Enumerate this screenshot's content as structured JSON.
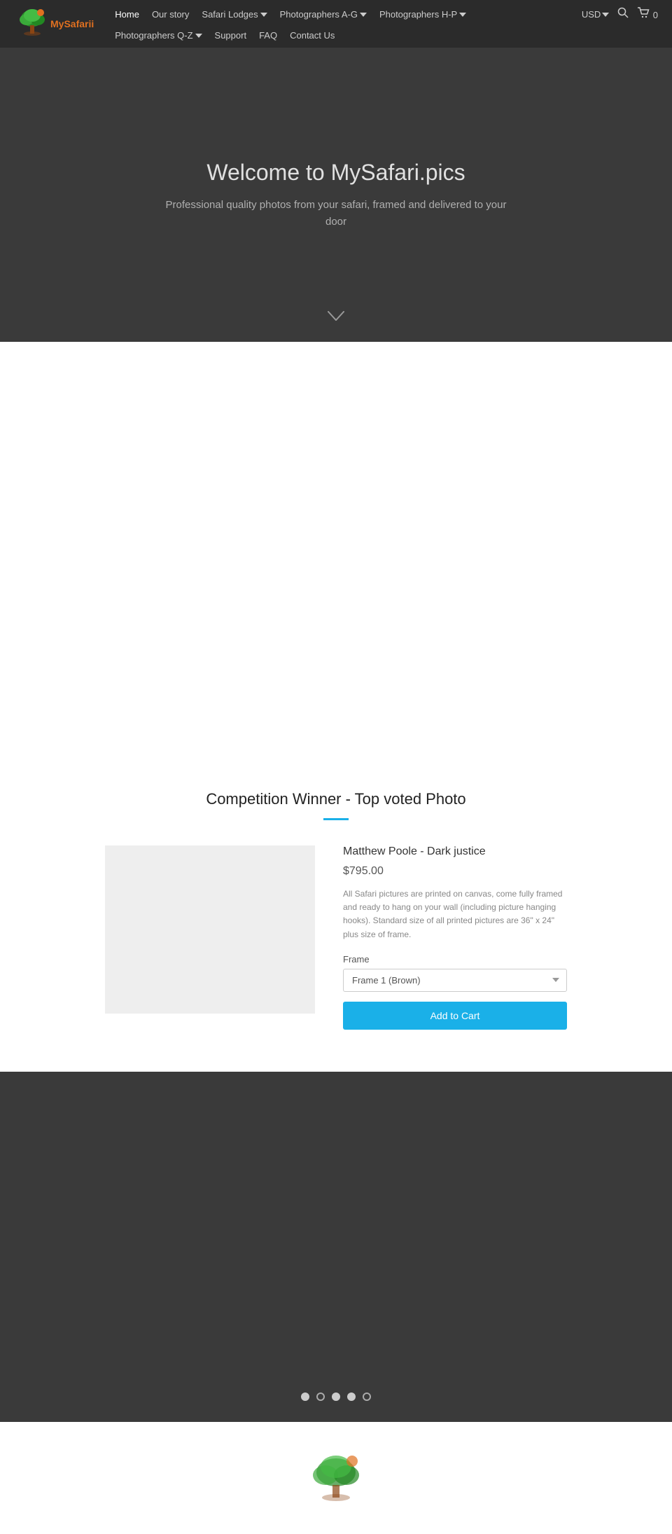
{
  "brand": {
    "name": "MySafarii",
    "logo_alt": "MySafarii Logo"
  },
  "navbar": {
    "currency": "USD",
    "cart_count": "0",
    "top_row": [
      {
        "label": "Home",
        "active": true,
        "has_dropdown": false
      },
      {
        "label": "Our story",
        "active": false,
        "has_dropdown": false
      },
      {
        "label": "Safari Lodges",
        "active": false,
        "has_dropdown": true
      },
      {
        "label": "Photographers A-G",
        "active": false,
        "has_dropdown": true
      },
      {
        "label": "Photographers H-P",
        "active": false,
        "has_dropdown": true
      }
    ],
    "bottom_row": [
      {
        "label": "Photographers Q-Z",
        "active": false,
        "has_dropdown": true
      },
      {
        "label": "Support",
        "active": false,
        "has_dropdown": false
      },
      {
        "label": "FAQ",
        "active": false,
        "has_dropdown": false
      },
      {
        "label": "Contact Us",
        "active": false,
        "has_dropdown": false
      }
    ]
  },
  "hero": {
    "title": "Welcome to MySafari.pics",
    "subtitle": "Professional quality photos from your safari, framed and delivered to your door"
  },
  "competition": {
    "heading": "Competition Winner - Top voted Photo",
    "product": {
      "title": "Matthew Poole - Dark justice",
      "price": "$795.00",
      "description": "All Safari pictures are printed on canvas, come fully framed and ready to hang on your wall (including picture hanging hooks). Standard size of all printed pictures are 36\" x 24\" plus size of frame.",
      "frame_label": "Frame",
      "frame_option": "Frame 1 (Brown)",
      "add_to_cart_label": "Add to Cart"
    }
  },
  "slideshow": {
    "dots": [
      {
        "active": true
      },
      {
        "active": false
      },
      {
        "active": true
      },
      {
        "active": true
      },
      {
        "active": false
      }
    ]
  }
}
